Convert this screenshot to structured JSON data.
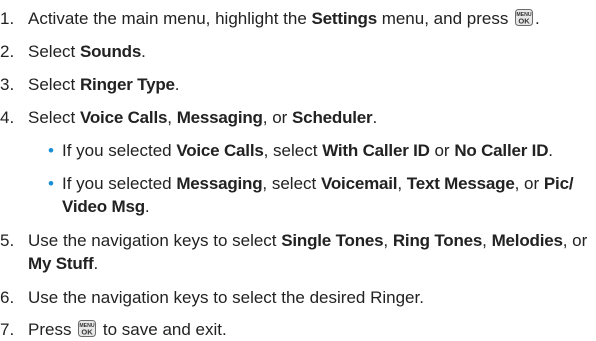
{
  "steps": [
    {
      "num": "1.",
      "parts": {
        "a": "Activate the main menu, highlight the ",
        "b": "Settings",
        "c": " menu, and press ",
        "d": "."
      }
    },
    {
      "num": "2.",
      "parts": {
        "a": "Select ",
        "b": "Sounds",
        "c": "."
      }
    },
    {
      "num": "3.",
      "parts": {
        "a": "Select ",
        "b": "Ringer Type",
        "c": "."
      }
    },
    {
      "num": "4.",
      "parts": {
        "a": "Select ",
        "b": "Voice Calls",
        "c": ", ",
        "d": "Messaging",
        "e": ", or ",
        "f": "Scheduler",
        "g": "."
      }
    },
    {
      "num": "5.",
      "parts": {
        "a": "Use the navigation keys to select ",
        "b": "Single Tones",
        "c": ", ",
        "d": "Ring Tones",
        "e": ", ",
        "f": "Melodies",
        "g": ", or ",
        "h": "My Stuff",
        "i": "."
      }
    },
    {
      "num": "6.",
      "parts": {
        "a": "Use the navigation keys to select the desired Ringer."
      }
    },
    {
      "num": "7.",
      "parts": {
        "a": "Press ",
        "b": " to save and exit."
      }
    }
  ],
  "bullets": [
    {
      "a": "If you selected ",
      "b": "Voice Calls",
      "c": ", select ",
      "d": "With Caller ID",
      "e": " or ",
      "f": "No Caller ID",
      "g": "."
    },
    {
      "a": "If you selected ",
      "b": "Messaging",
      "c": ", select ",
      "d": "Voicemail",
      "e": ", ",
      "f": "Text Message",
      "g": ", or ",
      "h": "Pic/ Video Msg",
      "i": "."
    }
  ],
  "key_icon": {
    "top_label": "MENU",
    "bottom_label": "OK",
    "name": "menu-ok-key-icon"
  },
  "colors": {
    "bullet": "#1a8fd6",
    "text": "#222222"
  }
}
